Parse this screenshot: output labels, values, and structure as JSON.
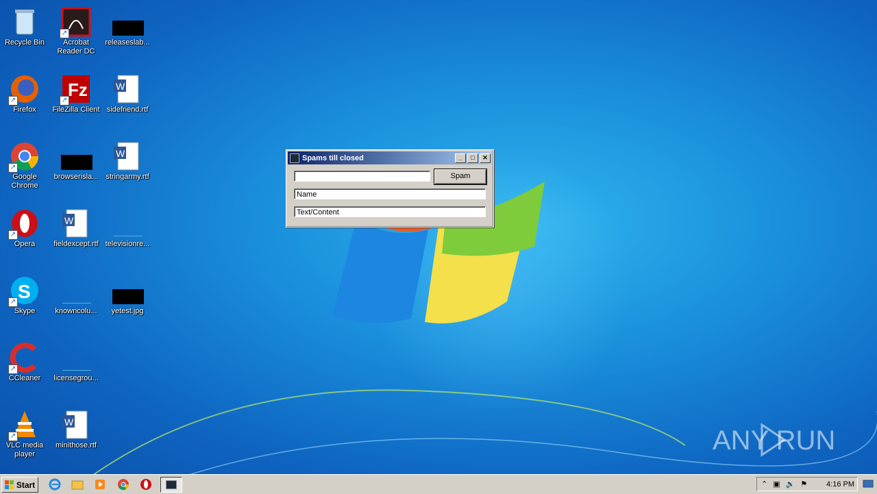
{
  "desktop": {
    "icons": [
      {
        "label": "Recycle Bin"
      },
      {
        "label": "Acrobat Reader DC"
      },
      {
        "label": "releaseslab..."
      },
      {
        "label": "Firefox"
      },
      {
        "label": "FileZilla Client"
      },
      {
        "label": "sidefriend.rtf"
      },
      {
        "label": "Google Chrome"
      },
      {
        "label": "browserisla..."
      },
      {
        "label": "stringarmy.rtf"
      },
      {
        "label": "Opera"
      },
      {
        "label": "fieldexcept.rtf"
      },
      {
        "label": "televisionre..."
      },
      {
        "label": "Skype"
      },
      {
        "label": "knowncolu..."
      },
      {
        "label": "yetest.jpg"
      },
      {
        "label": "CCleaner"
      },
      {
        "label": "licensegrou..."
      },
      {
        "label": "VLC media player"
      },
      {
        "label": "minithose.rtf"
      }
    ]
  },
  "window": {
    "title": "Spams till closed",
    "minimize": "_",
    "maximize": "□",
    "close": "✕",
    "count_value": "",
    "spam_button": "Spam",
    "name_value": "Name",
    "content_value": "Text/Content"
  },
  "taskbar": {
    "start_label": "Start",
    "clock": "4:16 PM"
  },
  "watermark": {
    "text": "ANY RUN"
  }
}
